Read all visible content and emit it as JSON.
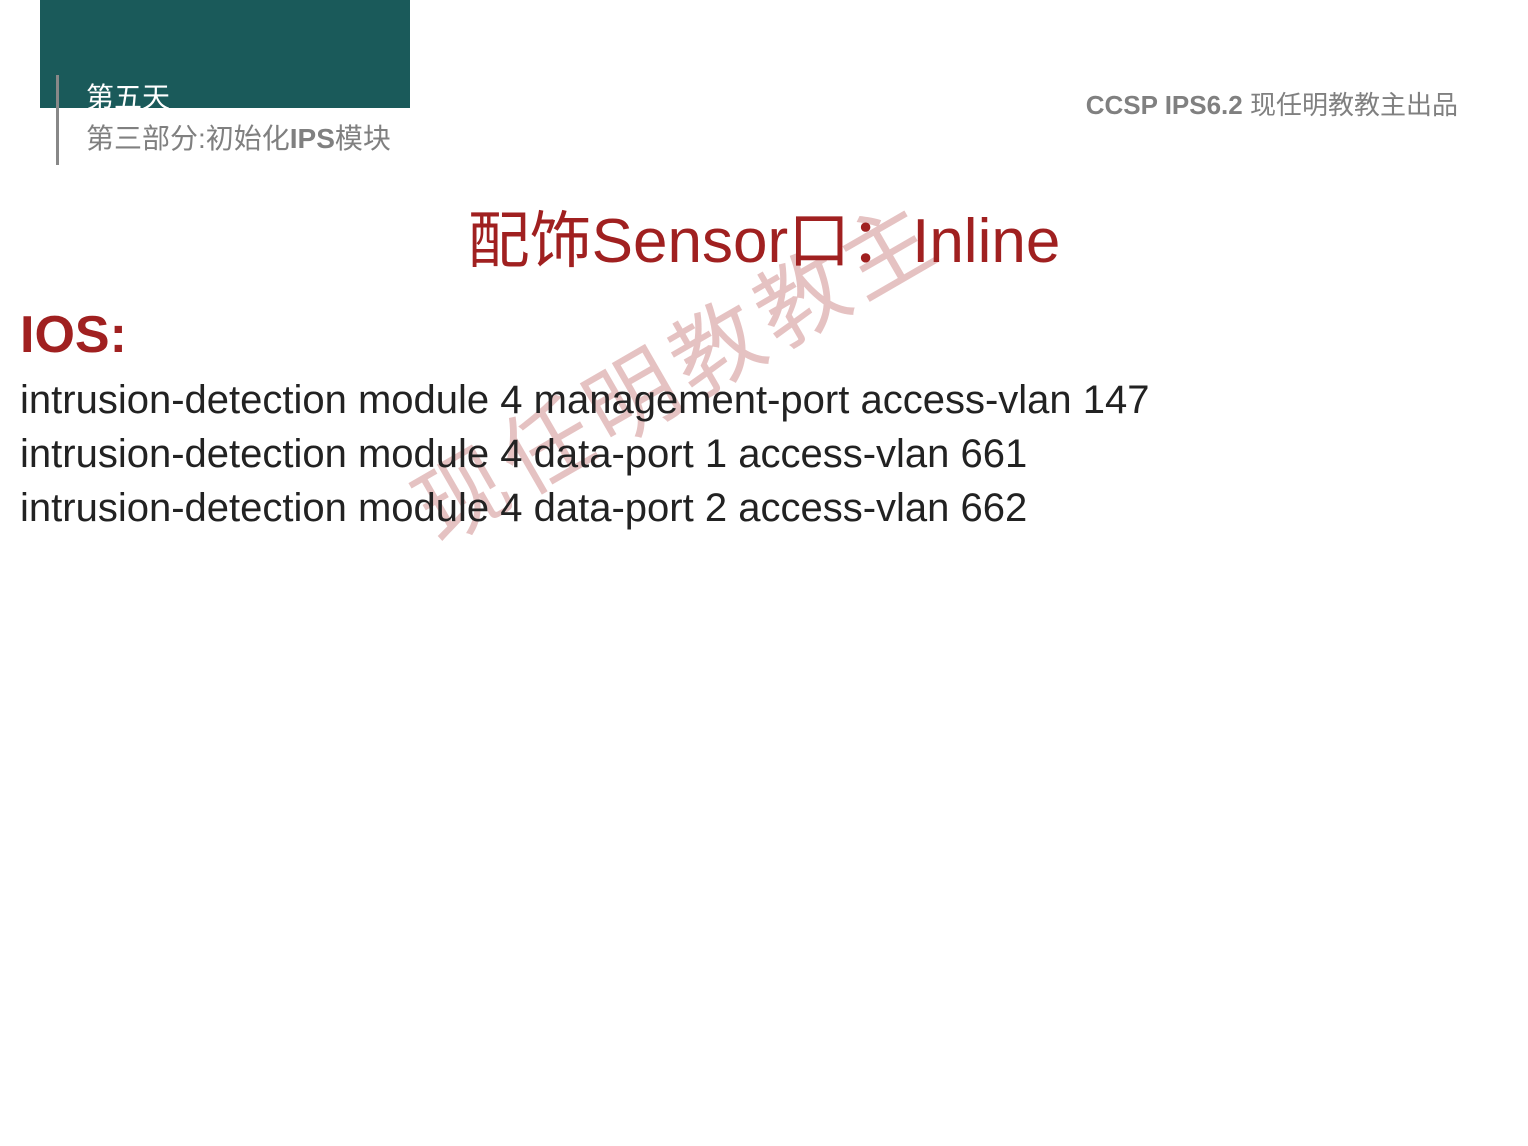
{
  "header": {
    "day": "第五天",
    "section_prefix": "第三部分:初始化",
    "section_bold": "IPS",
    "section_suffix": "模块",
    "course_code": "CCSP IPS6.2",
    "author": "现任明教教主出品"
  },
  "slide": {
    "title": "配饰Sensor口：Inline",
    "ios_heading": "IOS:",
    "code_lines": [
      "intrusion-detection module 4 management-port access-vlan 147",
      "intrusion-detection module 4 data-port 1 access-vlan 661",
      "intrusion-detection module 4 data-port 2 access-vlan 662"
    ]
  },
  "watermark": "现任明教教主"
}
